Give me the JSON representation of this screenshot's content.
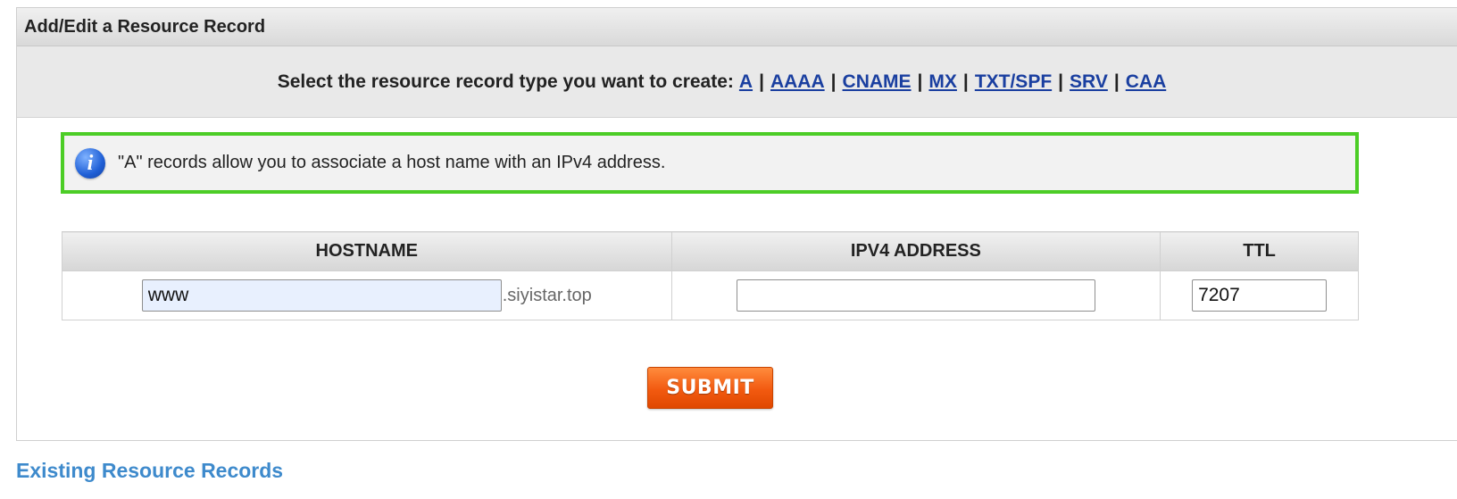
{
  "panel": {
    "title": "Add/Edit a Resource Record",
    "type_prompt": "Select the resource record type you want to create:",
    "types": [
      "A",
      "AAAA",
      "CNAME",
      "MX",
      "TXT/SPF",
      "SRV",
      "CAA"
    ],
    "separator": "|"
  },
  "info": {
    "icon": "info-icon",
    "icon_glyph": "i",
    "text": "\"A\" records allow you to associate a host name with an IPv4 address.",
    "border_color": "#4ccd26"
  },
  "table": {
    "headers": {
      "hostname": "HOSTNAME",
      "ipv4": "IPV4 ADDRESS",
      "ttl": "TTL"
    },
    "row": {
      "hostname_value": "www",
      "domain_suffix": ".siyistar.top",
      "ipv4_value": "",
      "ttl_value": "7207"
    }
  },
  "submit_label": "SUBMIT",
  "submit_color": "#f25a10",
  "existing_heading": "Existing Resource Records"
}
